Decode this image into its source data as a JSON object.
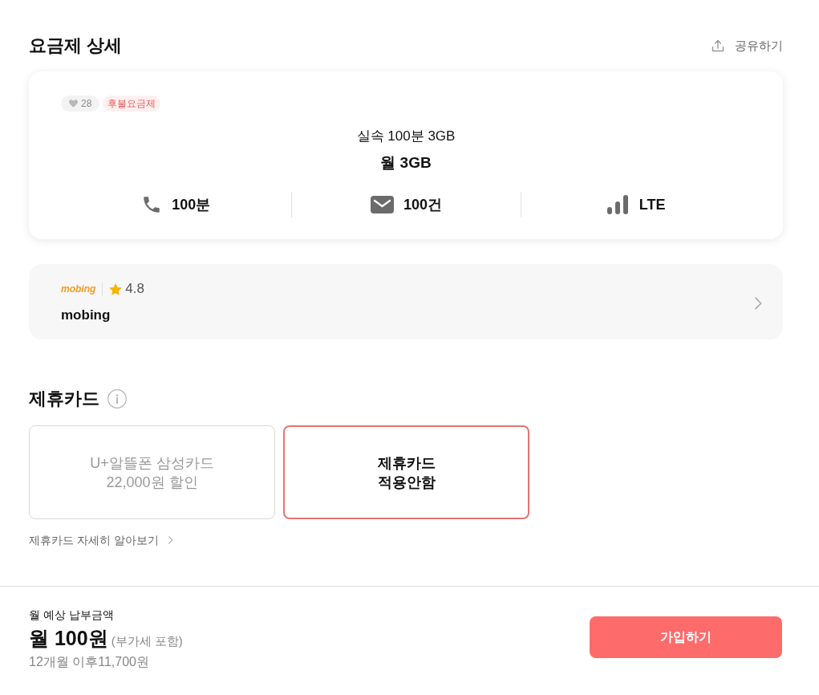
{
  "page_title": "요금제 상세",
  "share": {
    "label": "공유하기"
  },
  "plan": {
    "likes": "28",
    "tag": "후불요금제",
    "name": "실속 100분 3GB",
    "data_summary": "월 3GB",
    "features": [
      {
        "kind": "voice",
        "label": "100분"
      },
      {
        "kind": "sms",
        "label": "100건"
      },
      {
        "kind": "network",
        "label": "LTE"
      }
    ]
  },
  "provider": {
    "logo": "mobing",
    "rating": "4.8",
    "name": "mobing"
  },
  "affiliate_cards": {
    "title": "제휴카드",
    "options": [
      {
        "lines": [
          "U+알뜰폰 삼성카드",
          "22,000원 할인"
        ],
        "selected": false
      },
      {
        "lines": [
          "제휴카드",
          "적용안함"
        ],
        "selected": true
      }
    ],
    "more_link": "제휴카드 자세히 알아보기"
  },
  "footer": {
    "label": "월 예상 납부금액",
    "price": "월 100원",
    "vat_note": "(부가세 포함)",
    "after_note": "12개월 이후11,700원",
    "join_button": "가입하기"
  }
}
